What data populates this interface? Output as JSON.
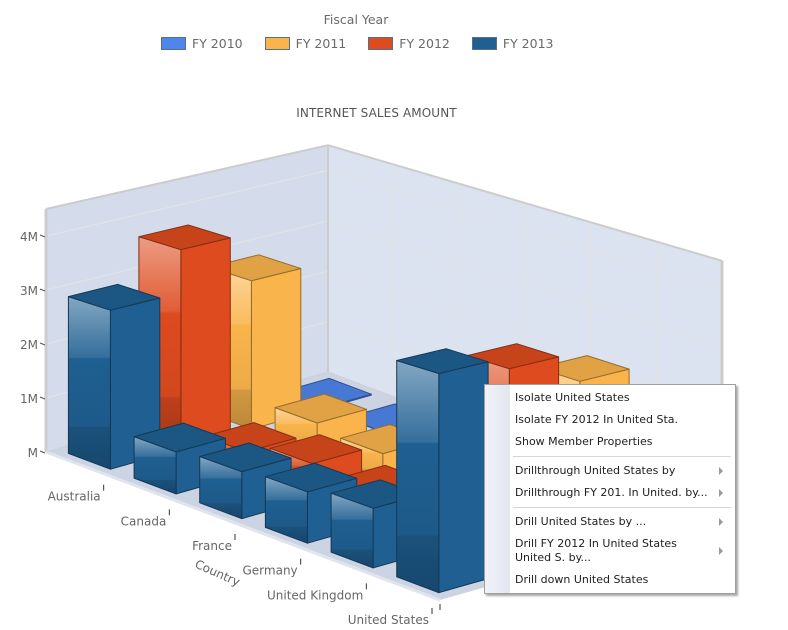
{
  "legend": {
    "title": "Fiscal Year",
    "items": [
      {
        "label": "FY 2010",
        "color": "#4f86ec"
      },
      {
        "label": "FY 2011",
        "color": "#f9b44b"
      },
      {
        "label": "FY 2012",
        "color": "#dd4b1e"
      },
      {
        "label": "FY 2013",
        "color": "#1f5f91"
      }
    ]
  },
  "chart_data": {
    "type": "bar",
    "subtype": "3d-column",
    "title": "INTERNET SALES AMOUNT",
    "xlabel": "Country",
    "ylabel": "",
    "zlabel": "Fiscal Year",
    "categories": [
      "Australia",
      "Canada",
      "France",
      "Germany",
      "United Kingdom",
      "United States"
    ],
    "y_ticks": [
      "M",
      "1M",
      "2M",
      "3M",
      "4M"
    ],
    "ylim": [
      0,
      4500000
    ],
    "grid": true,
    "legend_position": "top",
    "series": [
      {
        "name": "FY 2010",
        "color": "#4f86ec",
        "values": [
          20000,
          3000,
          3000,
          3000,
          3000,
          1600000
        ]
      },
      {
        "name": "FY 2011",
        "color": "#f9b44b",
        "values": [
          2800000,
          570000,
          450000,
          530000,
          590000,
          2900000
        ]
      },
      {
        "name": "FY 2012",
        "color": "#dd4b1e",
        "values": [
          3700000,
          400000,
          620000,
          500000,
          510000,
          3400000
        ]
      },
      {
        "name": "FY 2013",
        "color": "#1f5f91",
        "values": [
          2900000,
          750000,
          820000,
          880000,
          1000000,
          3600000
        ]
      }
    ]
  },
  "context_menu": {
    "items": [
      {
        "label": "Isolate United States",
        "submenu": false
      },
      {
        "label": "Isolate FY 2012 In United Sta.",
        "submenu": false
      },
      {
        "label": "Show Member Properties",
        "submenu": false
      },
      {
        "separator": true
      },
      {
        "label": "Drillthrough United States by",
        "submenu": true
      },
      {
        "label": "Drillthrough FY 201. In United. by...",
        "submenu": true
      },
      {
        "separator": true
      },
      {
        "label": "Drill United States by ...",
        "submenu": true
      },
      {
        "label": "Drill FY 2012 In United States United S. by...",
        "submenu": true
      },
      {
        "label": "Drill down United States",
        "submenu": false
      }
    ]
  }
}
